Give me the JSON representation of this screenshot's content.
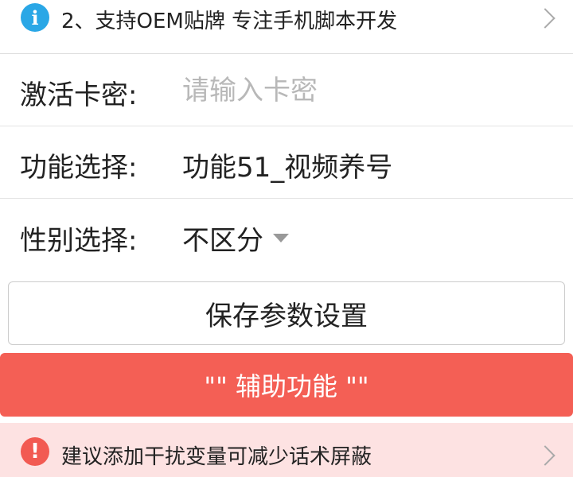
{
  "notices": {
    "top": {
      "text": "2、支持OEM贴牌 专注手机脚本开发",
      "icon": "info-icon",
      "icon_glyph": "i",
      "color": "#2aa7e6"
    },
    "bottom": {
      "text": "建议添加干扰变量可减少话术屏蔽",
      "icon": "alert-icon",
      "icon_glyph": "!",
      "color": "#f25a52"
    }
  },
  "form": {
    "activation": {
      "label": "激活卡密:",
      "placeholder": "请输入卡密",
      "value": ""
    },
    "function": {
      "label": "功能选择:",
      "value": "功能51_视频养号"
    },
    "gender": {
      "label": "性别选择:",
      "value": "不区分"
    }
  },
  "buttons": {
    "save": "保存参数设置"
  },
  "section": {
    "title": "\"\" 辅助功能 \"\""
  },
  "colors": {
    "accent_red": "#f45f55",
    "warn_bg": "#fde2e2",
    "info_blue": "#2aa7e6"
  }
}
